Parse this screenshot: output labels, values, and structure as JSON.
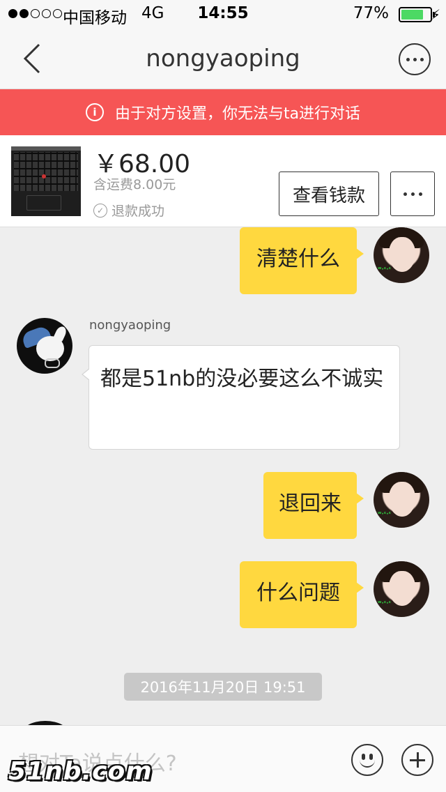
{
  "status_bar": {
    "carrier": "中国移动",
    "network": "4G",
    "time": "14:55",
    "battery": "77%",
    "battery_level": 0.77,
    "signal_bars_filled": 2,
    "signal_bars_total": 5
  },
  "nav": {
    "title": "nongyaoping",
    "back_icon": "chevron-left-icon",
    "more_icon": "more-horizontal-icon"
  },
  "warning": {
    "text": "由于对方设置，你无法与ta进行对话",
    "icon": "info-icon",
    "background": "#f65555"
  },
  "item": {
    "price": "￥68.00",
    "shipping": "含运费8.00元",
    "status": "退款成功",
    "view_button": "查看钱款"
  },
  "messages": [
    {
      "side": "me",
      "text": "清楚什么"
    },
    {
      "side": "other",
      "sender": "nongyaoping",
      "text": "都是51nb的没必要这么不诚实"
    },
    {
      "side": "me",
      "text": "退回来"
    },
    {
      "side": "me",
      "text": "什么问题"
    }
  ],
  "timestamp": "2016年11月20日 19:51",
  "input": {
    "placeholder": "想对Ta说点什么?"
  },
  "watermark": "51nb.com",
  "colors": {
    "my_bubble": "#ffd83f",
    "warning_banner": "#f65555"
  }
}
